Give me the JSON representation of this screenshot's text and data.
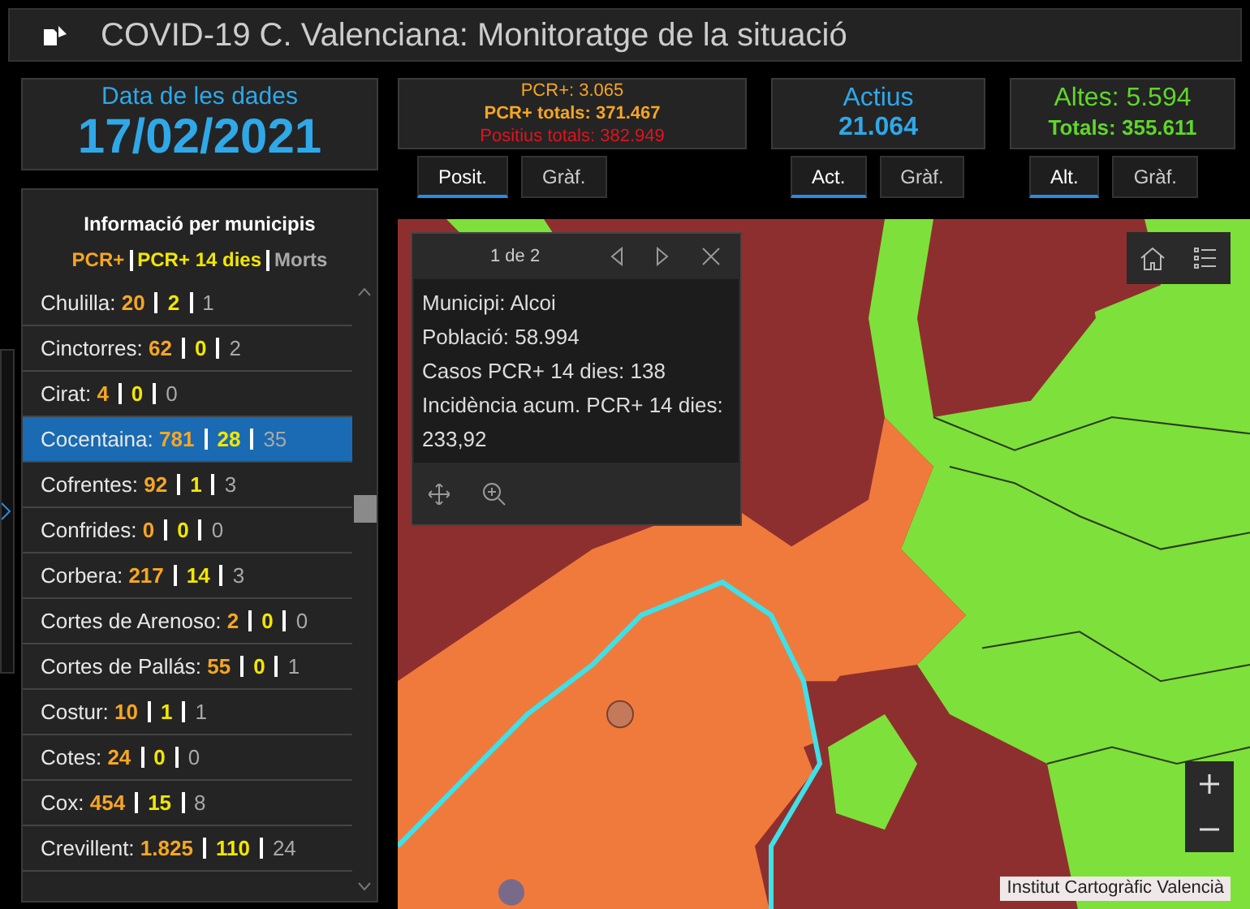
{
  "header": {
    "title": "COVID-19 C. Valenciana: Monitoratge de la situació"
  },
  "date_card": {
    "label": "Data de les dades",
    "value": "17/02/2021"
  },
  "cards": [
    {
      "kind": "pcr",
      "lines": [
        {
          "text": "PCR+: 3.065",
          "color": "#f5a623"
        },
        {
          "text": "PCR+ totals: 371.467",
          "color": "#f5a623"
        },
        {
          "text": "Positius totals: 382.949",
          "color": "#e0141e"
        }
      ],
      "tabs": [
        {
          "label": "Posit.",
          "selected": true
        },
        {
          "label": "Gràf.",
          "selected": false
        }
      ]
    },
    {
      "kind": "actius",
      "title": "Actius",
      "value": "21.064",
      "tabs": [
        {
          "label": "Act.",
          "selected": true
        },
        {
          "label": "Gràf.",
          "selected": false
        }
      ]
    },
    {
      "kind": "altes",
      "title": "Altes: 5.594",
      "value": "Totals: 355.611",
      "tabs": [
        {
          "label": "Alt.",
          "selected": true
        },
        {
          "label": "Gràf.",
          "selected": false
        }
      ]
    }
  ],
  "municipalities": {
    "title": "Informació per municipis",
    "legend": [
      {
        "label": "PCR+",
        "color": "#f5a623"
      },
      {
        "label": "PCR+ 14 dies",
        "color": "#f2e600"
      },
      {
        "label": "Morts",
        "color": "#a8a8a8"
      }
    ],
    "items": [
      {
        "name": "Chulilla:",
        "pcr": "20",
        "pcr14": "2",
        "deaths": "1",
        "selected": false
      },
      {
        "name": "Cinctorres:",
        "pcr": "62",
        "pcr14": "0",
        "deaths": "2",
        "selected": false
      },
      {
        "name": "Cirat:",
        "pcr": "4",
        "pcr14": "0",
        "deaths": "0",
        "selected": false
      },
      {
        "name": "Cocentaina:",
        "pcr": "781",
        "pcr14": "28",
        "deaths": "35",
        "selected": true
      },
      {
        "name": "Cofrentes:",
        "pcr": "92",
        "pcr14": "1",
        "deaths": "3",
        "selected": false
      },
      {
        "name": "Confrides:",
        "pcr": "0",
        "pcr14": "0",
        "deaths": "0",
        "selected": false
      },
      {
        "name": "Corbera:",
        "pcr": "217",
        "pcr14": "14",
        "deaths": "3",
        "selected": false
      },
      {
        "name": "Cortes de Arenoso:",
        "pcr": "2",
        "pcr14": "0",
        "deaths": "0",
        "selected": false
      },
      {
        "name": "Cortes de Pallás:",
        "pcr": "55",
        "pcr14": "0",
        "deaths": "1",
        "selected": false
      },
      {
        "name": "Costur:",
        "pcr": "10",
        "pcr14": "1",
        "deaths": "1",
        "selected": false
      },
      {
        "name": "Cotes:",
        "pcr": "24",
        "pcr14": "0",
        "deaths": "0",
        "selected": false
      },
      {
        "name": "Cox:",
        "pcr": "454",
        "pcr14": "15",
        "deaths": "8",
        "selected": false
      },
      {
        "name": "Crevillent:",
        "pcr": "1.825",
        "pcr14": "110",
        "deaths": "24",
        "selected": false
      }
    ]
  },
  "popup": {
    "pager": "1 de 2",
    "lines": [
      "Municipi: Alcoi",
      "Població: 58.994",
      "Casos PCR+ 14 dies: 138",
      "Incidència acum. PCR+ 14 dies: 233,92"
    ]
  },
  "attribution": "Institut Cartogràfic Valencià"
}
